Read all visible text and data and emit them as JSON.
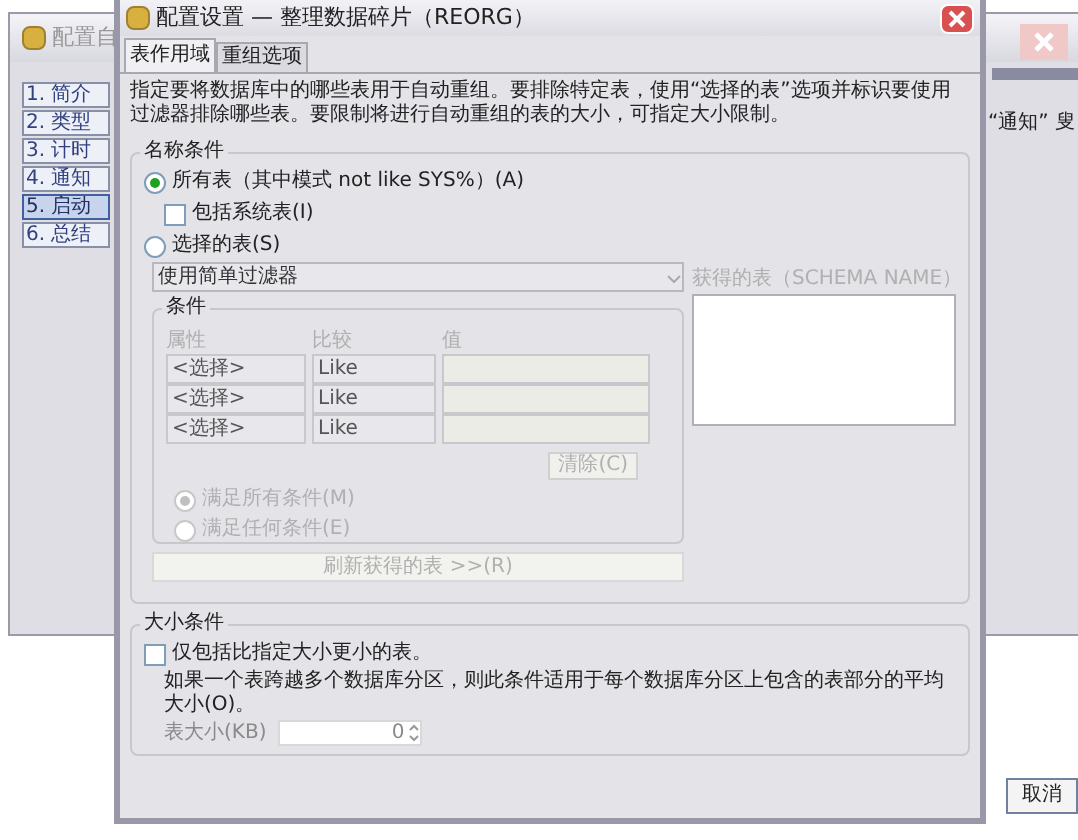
{
  "background_window": {
    "title": "配置自",
    "steps": [
      {
        "label": "1. 简介",
        "selected": false
      },
      {
        "label": "2. 类型",
        "selected": false
      },
      {
        "label": "3. 计时",
        "selected": false
      },
      {
        "label": "4. 通知",
        "selected": false
      },
      {
        "label": "5. 启动",
        "selected": true
      },
      {
        "label": "6. 总结",
        "selected": false
      }
    ],
    "text_fragment": "“通知” 叟",
    "cancel_button": "取消"
  },
  "dialog": {
    "title": "配置设置 — 整理数据碎片（REORG）",
    "tabs": [
      {
        "label": "表作用域",
        "selected": true
      },
      {
        "label": "重组选项",
        "selected": false
      }
    ],
    "description": "指定要将数据库中的哪些表用于自动重组。要排除特定表，使用“选择的表”选项并标识要使用过滤器排除哪些表。要限制将进行自动重组的表的大小，可指定大小限制。",
    "name_conditions": {
      "title": "名称条件",
      "all_tables": {
        "label": "所有表（其中模式 not like SYS%）(A)",
        "selected": true
      },
      "include_system": {
        "label": "包括系统表(I)",
        "checked": false
      },
      "selected_tables": {
        "label": "选择的表(S)",
        "selected": false
      },
      "filter_dropdown": {
        "value": "使用简单过滤器",
        "disabled": true
      },
      "conditions": {
        "title": "条件",
        "columns": [
          "属性",
          "比较",
          "值"
        ],
        "rows": [
          {
            "attribute": "<选择>",
            "comparison": "Like"
          },
          {
            "attribute": "<选择>",
            "comparison": "Like"
          },
          {
            "attribute": "<选择>",
            "comparison": "Like"
          }
        ],
        "clear_button": "清除(C)",
        "match": [
          {
            "label": "满足所有条件(M)",
            "selected": true
          },
          {
            "label": "满足任何条件(E)",
            "selected": false
          }
        ],
        "disabled": true
      },
      "refresh_button": "刷新获得的表 >>(R)",
      "result_label": "获得的表（SCHEMA NAME）"
    },
    "size_conditions": {
      "title": "大小条件",
      "limit": {
        "label": "仅包括比指定大小更小的表。",
        "checked": false
      },
      "note": "如果一个表跨越多个数据库分区，则此条件适用于每个数据库分区上包含的表部分的平均大小(O)。",
      "size_label": "表大小(KB)",
      "size_value": "0",
      "disabled": true
    }
  }
}
